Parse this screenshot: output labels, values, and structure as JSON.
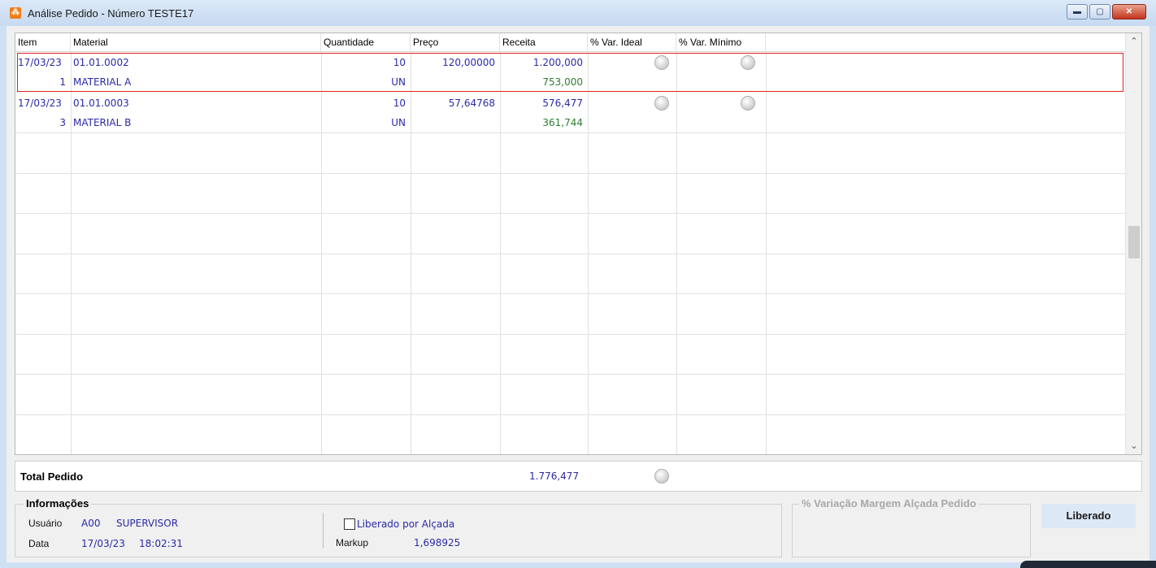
{
  "window": {
    "title": "Análise Pedido - Número TESTE17",
    "icon": "app-logo-icon",
    "controls": [
      "minimize",
      "maximize",
      "close"
    ]
  },
  "grid": {
    "columns": [
      "Item",
      "Material",
      "Quantidade",
      "Preço",
      "Receita",
      "% Var. Ideal",
      "% Var. Mínimo"
    ],
    "rows": [
      {
        "date": "17/03/23",
        "item_no": "1",
        "code": "01.01.0002",
        "name": "MATERIAL A",
        "quantity": "10",
        "unit": "UN",
        "price": "120,00000",
        "revenue": "1.200,000",
        "revenue_sub": "753,000",
        "selected": true
      },
      {
        "date": "17/03/23",
        "item_no": "3",
        "code": "01.01.0003",
        "name": "MATERIAL B",
        "quantity": "10",
        "unit": "UN",
        "price": "57,64768",
        "revenue": "576,477",
        "revenue_sub": "361,744",
        "selected": false
      }
    ]
  },
  "total": {
    "label": "Total Pedido",
    "value": "1.776,477"
  },
  "info": {
    "legend": "Informações",
    "user_label": "Usuário",
    "user_code": "A00",
    "user_name": "SUPERVISOR",
    "date_label": "Data",
    "date": "17/03/23",
    "time": "18:02:31",
    "checkbox_label": "Liberado por Alçada",
    "markup_label": "Markup",
    "markup_value": "1,698925"
  },
  "margin_group": {
    "legend": "% Variação Margem Alçada Pedido"
  },
  "status_button": "Liberado",
  "colors": {
    "value_blue": "#2a2aa8",
    "value_green": "#2e7d32",
    "selection_red": "#e02020"
  }
}
